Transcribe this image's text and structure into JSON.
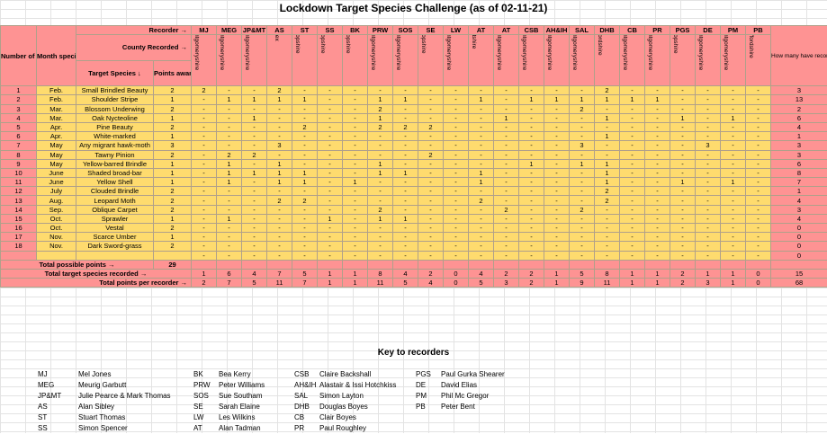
{
  "title": "Lockdown Target Species Challenge (as of 02-11-21)",
  "header": {
    "recorder_label": "Recorder →",
    "county_label": "County Recorded →",
    "number_col": "Number of targeted species in challenge",
    "month_col": "Month species was added to challenge",
    "species_col": "Target Species ↓",
    "points_col": "Points awarded",
    "total_col": "How many have recorded each target species"
  },
  "recorders": [
    {
      "code": "MJ",
      "county": "Montgomeryshire"
    },
    {
      "code": "MEG",
      "county": "Montgomeryshire"
    },
    {
      "code": "JP&MT",
      "county": "Montgomeryshire"
    },
    {
      "code": "AS",
      "county": "Essex"
    },
    {
      "code": "ST",
      "county": "Shropshire"
    },
    {
      "code": "SS",
      "county": "Shropshire"
    },
    {
      "code": "BK",
      "county": "Shropshire"
    },
    {
      "code": "PRW",
      "county": "Montgomeryshire"
    },
    {
      "code": "SOS",
      "county": "Montgomeryshire"
    },
    {
      "code": "SE",
      "county": "Shropshire"
    },
    {
      "code": "LW",
      "county": "Montgomeryshire"
    },
    {
      "code": "AT",
      "county": "Flintshire"
    },
    {
      "code": "AT",
      "county": "Montgomeryshire"
    },
    {
      "code": "CSB",
      "county": "Montgomeryshire"
    },
    {
      "code": "AH&IH",
      "county": "Montgomeryshire"
    },
    {
      "code": "SAL",
      "county": "Montgomeryshire"
    },
    {
      "code": "DHB",
      "county": "Oxfordshire"
    },
    {
      "code": "CB",
      "county": "Montgomeryshire"
    },
    {
      "code": "PR",
      "county": "Montgomeryshire"
    },
    {
      "code": "PGS",
      "county": "Shropshire"
    },
    {
      "code": "DE",
      "county": "Montgomeryshire"
    },
    {
      "code": "PM",
      "county": "Montgomeryshire"
    },
    {
      "code": "PB",
      "county": "Staffordshire"
    }
  ],
  "species": [
    {
      "n": "1",
      "month": "Feb.",
      "name": "Small Brindled Beauty",
      "points": "2",
      "cells": [
        "2",
        "-",
        "-",
        "2",
        "-",
        "-",
        "-",
        "-",
        "-",
        "-",
        "-",
        "-",
        "-",
        "-",
        "-",
        "-",
        "2",
        "-",
        "-",
        "-",
        "-",
        "-",
        "-"
      ],
      "total": "3"
    },
    {
      "n": "2",
      "month": "Feb.",
      "name": "Shoulder Stripe",
      "points": "1",
      "cells": [
        "-",
        "1",
        "1",
        "1",
        "1",
        "-",
        "-",
        "1",
        "1",
        "-",
        "-",
        "1",
        "-",
        "1",
        "1",
        "1",
        "1",
        "1",
        "1",
        "-",
        "-",
        "-",
        "-"
      ],
      "total": "13"
    },
    {
      "n": "3",
      "month": "Mar.",
      "name": "Blossom Underwing",
      "points": "2",
      "cells": [
        "-",
        "-",
        "-",
        "-",
        "-",
        "-",
        "-",
        "2",
        "-",
        "-",
        "-",
        "-",
        "-",
        "-",
        "-",
        "2",
        "-",
        "-",
        "-",
        "-",
        "-",
        "-",
        "-"
      ],
      "total": "2"
    },
    {
      "n": "4",
      "month": "Mar.",
      "name": "Oak Nycteoline",
      "points": "1",
      "cells": [
        "-",
        "-",
        "1",
        "-",
        "-",
        "-",
        "-",
        "1",
        "-",
        "-",
        "-",
        "-",
        "1",
        "-",
        "-",
        "-",
        "1",
        "-",
        "-",
        "1",
        "-",
        "1",
        "-"
      ],
      "total": "6"
    },
    {
      "n": "5",
      "month": "Apr.",
      "name": "Pine Beauty",
      "points": "2",
      "cells": [
        "-",
        "-",
        "-",
        "-",
        "2",
        "-",
        "-",
        "2",
        "2",
        "2",
        "-",
        "-",
        "-",
        "-",
        "-",
        "-",
        "-",
        "-",
        "-",
        "-",
        "-",
        "-",
        "-"
      ],
      "total": "4"
    },
    {
      "n": "6",
      "month": "Apr.",
      "name": "White-marked",
      "points": "1",
      "cells": [
        "-",
        "-",
        "-",
        "-",
        "-",
        "-",
        "-",
        "-",
        "-",
        "-",
        "-",
        "-",
        "-",
        "-",
        "-",
        "-",
        "1",
        "-",
        "-",
        "-",
        "-",
        "-",
        "-"
      ],
      "total": "1"
    },
    {
      "n": "7",
      "month": "May",
      "name": "Any migrant hawk-moth",
      "points": "3",
      "cells": [
        "-",
        "-",
        "-",
        "3",
        "-",
        "-",
        "-",
        "-",
        "-",
        "-",
        "-",
        "-",
        "-",
        "-",
        "-",
        "3",
        "-",
        "-",
        "-",
        "-",
        "3",
        "-",
        "-"
      ],
      "total": "3"
    },
    {
      "n": "8",
      "month": "May",
      "name": "Tawny Pinion",
      "points": "2",
      "cells": [
        "-",
        "2",
        "2",
        "-",
        "-",
        "-",
        "-",
        "-",
        "-",
        "2",
        "-",
        "-",
        "-",
        "-",
        "-",
        "-",
        "-",
        "-",
        "-",
        "-",
        "-",
        "-",
        "-"
      ],
      "total": "3"
    },
    {
      "n": "9",
      "month": "May",
      "name": "Yellow-barred Brindle",
      "points": "1",
      "cells": [
        "-",
        "1",
        "-",
        "1",
        "-",
        "-",
        "-",
        "1",
        "-",
        "-",
        "-",
        "-",
        "-",
        "1",
        "-",
        "1",
        "1",
        "-",
        "-",
        "-",
        "-",
        "-",
        "-"
      ],
      "total": "6"
    },
    {
      "n": "10",
      "month": "June",
      "name": "Shaded broad-bar",
      "points": "1",
      "cells": [
        "-",
        "1",
        "1",
        "1",
        "1",
        "-",
        "-",
        "1",
        "1",
        "-",
        "-",
        "1",
        "-",
        "-",
        "-",
        "-",
        "1",
        "-",
        "-",
        "-",
        "-",
        "-",
        "-"
      ],
      "total": "8"
    },
    {
      "n": "11",
      "month": "June",
      "name": "Yellow Shell",
      "points": "1",
      "cells": [
        "-",
        "1",
        "-",
        "1",
        "1",
        "-",
        "1",
        "-",
        "-",
        "-",
        "-",
        "1",
        "-",
        "-",
        "-",
        "-",
        "1",
        "-",
        "-",
        "1",
        "-",
        "1",
        "-"
      ],
      "total": "7"
    },
    {
      "n": "12",
      "month": "July",
      "name": "Clouded Brindle",
      "points": "2",
      "cells": [
        "-",
        "-",
        "-",
        "-",
        "-",
        "-",
        "-",
        "-",
        "-",
        "-",
        "-",
        "-",
        "-",
        "-",
        "-",
        "-",
        "2",
        "-",
        "-",
        "-",
        "-",
        "-",
        "-"
      ],
      "total": "1"
    },
    {
      "n": "13",
      "month": "Aug.",
      "name": "Leopard Moth",
      "points": "2",
      "cells": [
        "-",
        "-",
        "-",
        "2",
        "2",
        "-",
        "-",
        "-",
        "-",
        "-",
        "-",
        "2",
        "-",
        "-",
        "-",
        "-",
        "2",
        "-",
        "-",
        "-",
        "-",
        "-",
        "-"
      ],
      "total": "4"
    },
    {
      "n": "14",
      "month": "Sep.",
      "name": "Oblique Carpet",
      "points": "2",
      "cells": [
        "-",
        "-",
        "-",
        "-",
        "-",
        "-",
        "-",
        "2",
        "-",
        "-",
        "-",
        "-",
        "2",
        "-",
        "-",
        "2",
        "-",
        "-",
        "-",
        "-",
        "-",
        "-",
        "-"
      ],
      "total": "3"
    },
    {
      "n": "15",
      "month": "Oct.",
      "name": "Sprawler",
      "points": "1",
      "cells": [
        "-",
        "1",
        "-",
        "-",
        "-",
        "1",
        "-",
        "1",
        "1",
        "-",
        "-",
        "-",
        "-",
        "-",
        "-",
        "-",
        "-",
        "-",
        "-",
        "-",
        "-",
        "-",
        "-"
      ],
      "total": "4"
    },
    {
      "n": "16",
      "month": "Oct.",
      "name": "Vestal",
      "points": "2",
      "cells": [
        "-",
        "-",
        "-",
        "-",
        "-",
        "-",
        "-",
        "-",
        "-",
        "-",
        "-",
        "-",
        "-",
        "-",
        "-",
        "-",
        "-",
        "-",
        "-",
        "-",
        "-",
        "-",
        "-"
      ],
      "total": "0"
    },
    {
      "n": "17",
      "month": "Nov.",
      "name": "Scarce Umber",
      "points": "1",
      "cells": [
        "-",
        "-",
        "-",
        "-",
        "-",
        "-",
        "-",
        "-",
        "-",
        "-",
        "-",
        "-",
        "-",
        "-",
        "-",
        "-",
        "-",
        "-",
        "-",
        "-",
        "-",
        "-",
        "-"
      ],
      "total": "0"
    },
    {
      "n": "18",
      "month": "Nov.",
      "name": "Dark Sword-grass",
      "points": "2",
      "cells": [
        "-",
        "-",
        "-",
        "-",
        "-",
        "-",
        "-",
        "-",
        "-",
        "-",
        "-",
        "-",
        "-",
        "-",
        "-",
        "-",
        "-",
        "-",
        "-",
        "-",
        "-",
        "-",
        "-"
      ],
      "total": "0"
    }
  ],
  "blank_row": {
    "cells": [
      "-",
      "-",
      "-",
      "-",
      "-",
      "-",
      "-",
      "-",
      "-",
      "-",
      "-",
      "-",
      "-",
      "-",
      "-",
      "-",
      "-",
      "-",
      "-",
      "-",
      "-",
      "-",
      "-"
    ],
    "total": "0"
  },
  "totals": {
    "possible_label": "Total possible points →",
    "possible_value": "29",
    "species_label": "Total target species recorded →",
    "species_values": [
      "1",
      "6",
      "4",
      "7",
      "5",
      "1",
      "1",
      "8",
      "4",
      "2",
      "0",
      "4",
      "2",
      "2",
      "1",
      "5",
      "8",
      "1",
      "1",
      "2",
      "1",
      "1",
      "0"
    ],
    "species_total": "15",
    "points_label": "Total points per recorder →",
    "points_values": [
      "2",
      "7",
      "5",
      "11",
      "7",
      "1",
      "1",
      "11",
      "5",
      "4",
      "0",
      "5",
      "3",
      "2",
      "1",
      "9",
      "11",
      "1",
      "1",
      "2",
      "3",
      "1",
      "0"
    ],
    "points_total": "68"
  },
  "key": {
    "title": "Key to recorders",
    "columns": [
      [
        {
          "code": "MJ",
          "name": "Mel Jones"
        },
        {
          "code": "MEG",
          "name": "Meurig Garbutt"
        },
        {
          "code": "JP&MT",
          "name": "Julie Pearce & Mark Thomas"
        },
        {
          "code": "AS",
          "name": "Alan Sibley"
        },
        {
          "code": "ST",
          "name": "Stuart Thomas"
        },
        {
          "code": "SS",
          "name": "Simon Spencer"
        }
      ],
      [
        {
          "code": "BK",
          "name": "Bea Kerry"
        },
        {
          "code": "PRW",
          "name": "Peter Williams"
        },
        {
          "code": "SOS",
          "name": "Sue Southam"
        },
        {
          "code": "SE",
          "name": "Sarah Elaine"
        },
        {
          "code": "LW",
          "name": "Les Wilkins"
        },
        {
          "code": "AT",
          "name": "Alan Tadman"
        }
      ],
      [
        {
          "code": "CSB",
          "name": "Claire Backshall"
        },
        {
          "code": "AH&IH",
          "name": "Alastair & Issi Hotchkiss"
        },
        {
          "code": "SAL",
          "name": "Simon Layton"
        },
        {
          "code": "DHB",
          "name": "Douglas Boyes"
        },
        {
          "code": "CB",
          "name": "Clair Boyes"
        },
        {
          "code": "PR",
          "name": "Paul Roughley"
        }
      ],
      [
        {
          "code": "PGS",
          "name": "Paul Gurka Shearer"
        },
        {
          "code": "DE",
          "name": "David Elias"
        },
        {
          "code": "PM",
          "name": "Phil Mc Gregor"
        },
        {
          "code": "PB",
          "name": "Peter Bent"
        }
      ]
    ]
  }
}
